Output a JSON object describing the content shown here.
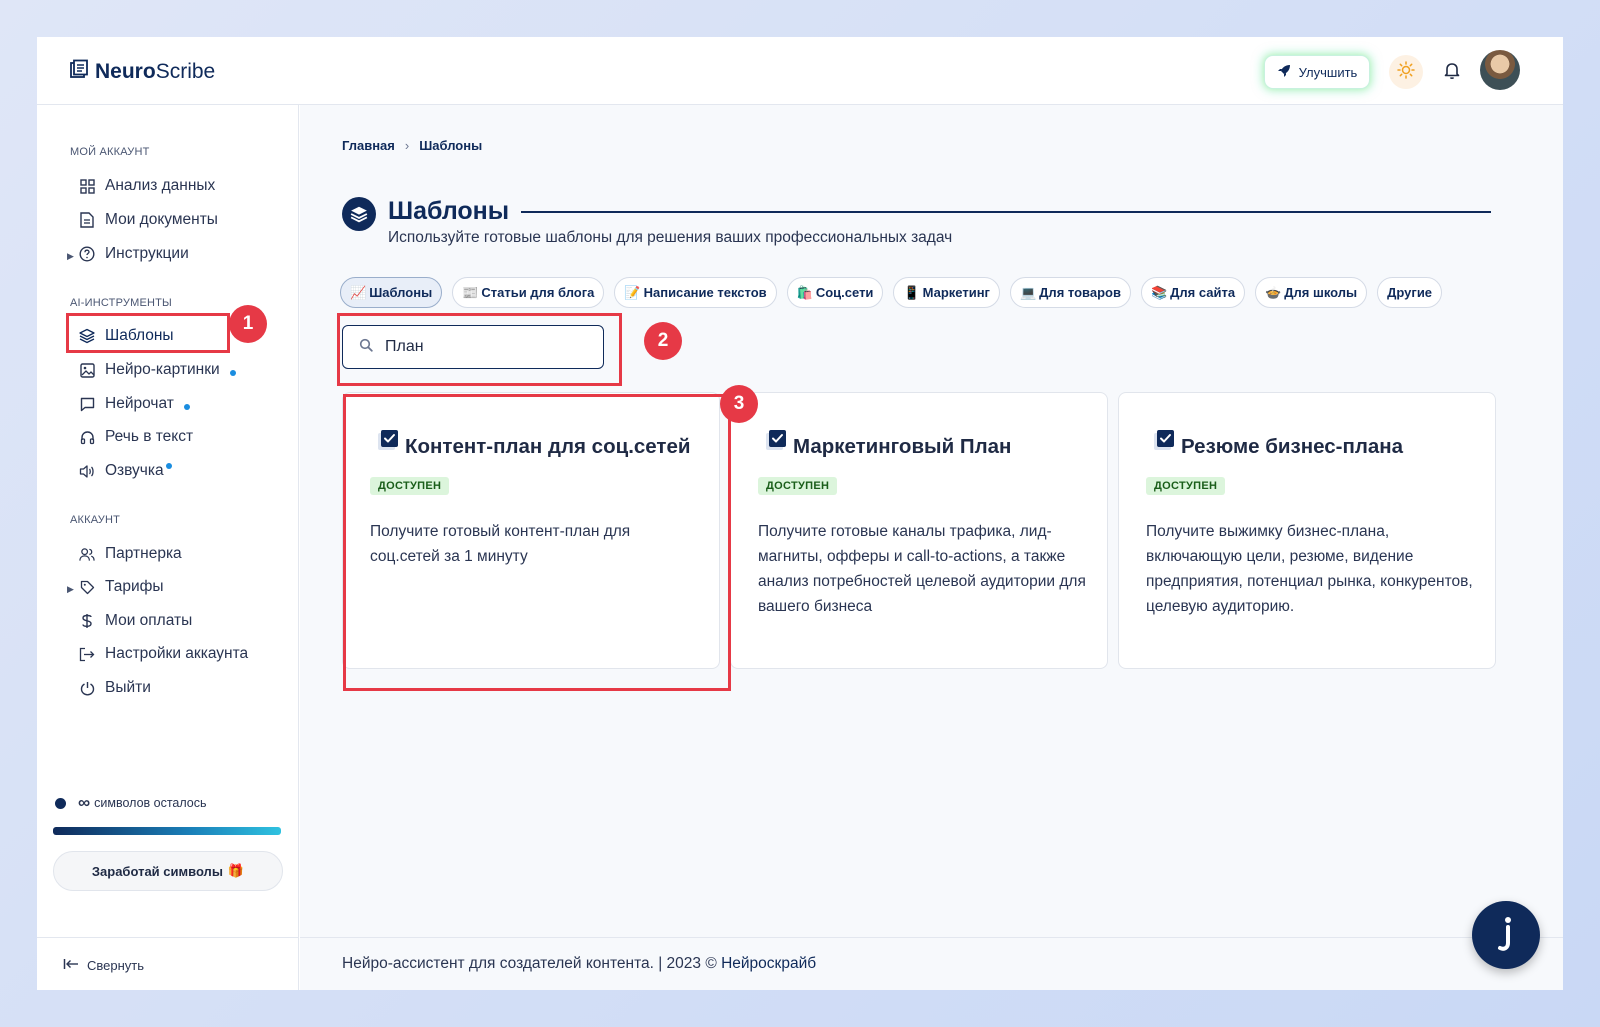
{
  "header": {
    "logo_bold": "Neuro",
    "logo_rest": "Scribe",
    "upgrade_label": "Улучшить"
  },
  "sidebar": {
    "section_account": "МОЙ АККАУНТ",
    "section_ai": "AI-ИНСТРУМЕНТЫ",
    "section_profile": "АККАУНТ",
    "items": [
      {
        "label": "Анализ данных"
      },
      {
        "label": "Мои документы"
      },
      {
        "label": "Инструкции"
      },
      {
        "label": "Шаблоны"
      },
      {
        "label": "Нейро-картинки"
      },
      {
        "label": "Нейрочат"
      },
      {
        "label": "Речь в текст"
      },
      {
        "label": "Озвучка"
      },
      {
        "label": "Партнерка"
      },
      {
        "label": "Тарифы"
      },
      {
        "label": "Мои оплаты"
      },
      {
        "label": "Настройки аккаунта"
      },
      {
        "label": "Выйти"
      }
    ],
    "credits_symbol": "∞",
    "credits_label": "символов осталось",
    "earn_label": "Заработай символы",
    "earn_emoji": "🎁",
    "collapse_label": "Свернуть"
  },
  "main": {
    "breadcrumb": [
      "Главная",
      "Шаблоны"
    ],
    "breadcrumb_sep": "›",
    "title": "Шаблоны",
    "subtitle": "Используйте готовые шаблоны для решения ваших профессиональных задач",
    "tabs": [
      {
        "emoji": "📈",
        "label": "Шаблоны"
      },
      {
        "emoji": "📰",
        "label": "Статьи для блога"
      },
      {
        "emoji": "📝",
        "label": "Написание текстов"
      },
      {
        "emoji": "🛍️",
        "label": "Соц.сети"
      },
      {
        "emoji": "📱",
        "label": "Маркетинг"
      },
      {
        "emoji": "💻",
        "label": "Для товаров"
      },
      {
        "emoji": "📚",
        "label": "Для сайта"
      },
      {
        "emoji": "🍲",
        "label": "Для школы"
      },
      {
        "emoji": "",
        "label": "Другие"
      }
    ],
    "search_value": "План",
    "cards": [
      {
        "title": "Контент-план для соц.сетей",
        "status": "ДОСТУПЕН",
        "desc": "Получите готовый контент-план для соц.сетей за 1 минуту"
      },
      {
        "title": "Маркетинговый План",
        "status": "ДОСТУПЕН",
        "desc": "Получите готовые каналы трафика, лид-магниты, офферы и call-to-actions, а также анализ потребностей целевой аудитории для вашего бизнеса"
      },
      {
        "title": "Резюме бизнес-плана",
        "status": "ДОСТУПЕН",
        "desc": "Получите выжимку бизнес-плана, включающую цели, резюме, видение предприятия, потенциал рынка, конкурентов, целевую аудиторию."
      }
    ],
    "footer_text": "Нейро-ассистент для создателей контента.  | 2023 ©",
    "footer_link": "Нейроскрайб"
  },
  "annotations": [
    "1",
    "2",
    "3"
  ],
  "colors": {
    "accent": "#0f2a5a",
    "highlight": "#e63946",
    "status_bg": "#dcf5dc"
  }
}
